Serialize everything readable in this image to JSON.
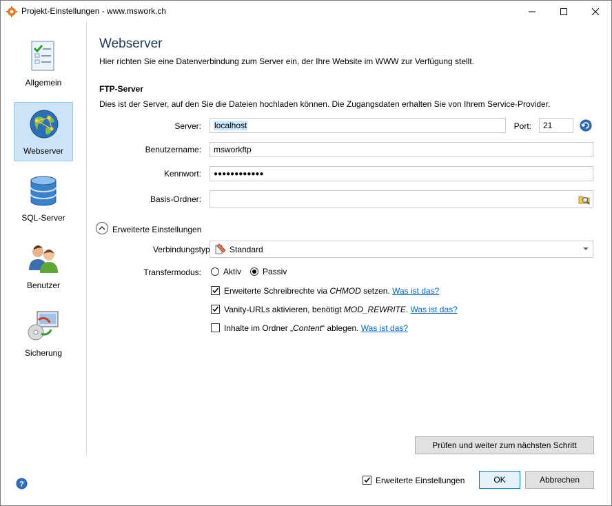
{
  "window": {
    "title": "Projekt-Einstellungen - www.mswork.ch"
  },
  "sidebar": {
    "items": [
      {
        "label": "Allgemein",
        "icon": "checklist-icon"
      },
      {
        "label": "Webserver",
        "icon": "globe-icon"
      },
      {
        "label": "SQL-Server",
        "icon": "database-icon"
      },
      {
        "label": "Benutzer",
        "icon": "users-icon"
      },
      {
        "label": "Sicherung",
        "icon": "backup-icon"
      }
    ]
  },
  "page": {
    "title": "Webserver",
    "description": "Hier richten Sie eine Datenverbindung zum Server ein, der Ihre Website im WWW zur Verfügung stellt."
  },
  "ftp": {
    "heading": "FTP-Server",
    "description": "Dies ist der Server, auf den Sie die Dateien hochladen können. Die Zugangsdaten erhalten Sie von Ihrem Service-Provider.",
    "server_label": "Server:",
    "server_value": "localhost",
    "port_label": "Port:",
    "port_value": "21",
    "user_label": "Benutzername:",
    "user_value": "msworkftp",
    "password_label": "Kennwort:",
    "password_mask": "●●●●●●●●●●●●",
    "folder_label": "Basis-Ordner:",
    "folder_value": ""
  },
  "advanced": {
    "toggle_label": "Erweiterte Einstellungen",
    "connection_label": "Verbindungstyp:",
    "connection_value": "Standard",
    "transfer_label": "Transfermodus:",
    "mode_active": "Aktiv",
    "mode_passive": "Passiv",
    "selected_mode": "Passiv",
    "options": [
      {
        "checked": true,
        "text_before": "Erweiterte Schreibrechte via ",
        "emph": "CHMOD",
        "text_after": " setzen.",
        "link": "Was ist das?"
      },
      {
        "checked": true,
        "text_before": "Vanity-URLs aktivieren, benötigt ",
        "emph": "MOD_REWRITE",
        "text_after": ".",
        "link": "Was ist das?"
      },
      {
        "checked": false,
        "text_before": "Inhalte im Ordner „",
        "emph": "Content",
        "text_after": "“ ablegen.",
        "link": "Was ist das?"
      }
    ]
  },
  "footer": {
    "check_next_button": "Prüfen und weiter zum nächsten Schritt",
    "advanced_checkbox_label": "Erweiterte Einstellungen",
    "advanced_checked": true,
    "ok_button": "OK",
    "cancel_button": "Abbrechen"
  },
  "colors": {
    "accent": "#0078d7",
    "selected_bg": "#cde4f7",
    "link": "#0066cc",
    "title": "#1f3a5a"
  }
}
